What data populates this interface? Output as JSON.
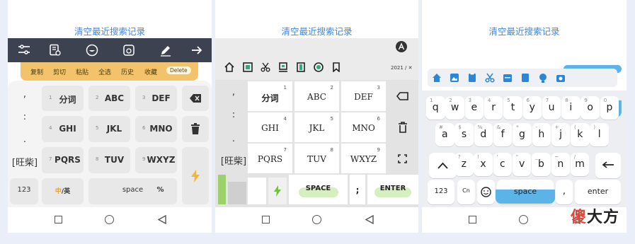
{
  "clear_history": "清空最近搜索记录",
  "panel1": {
    "clipboard": [
      "复制",
      "剪切",
      "粘贴",
      "全选",
      "历史",
      "收藏"
    ],
    "delete_label": "Delete",
    "side": [
      ",",
      ":",
      ".",
      "[旺柴]"
    ],
    "keys": [
      {
        "num": "1",
        "label": "分词"
      },
      {
        "num": "2",
        "label": "ABC"
      },
      {
        "num": "3",
        "label": "DEF"
      },
      {
        "num": "4",
        "label": "GHI"
      },
      {
        "num": "5",
        "label": "JKL"
      },
      {
        "num": "6",
        "label": "MNO"
      },
      {
        "num": "7",
        "label": "PQRS"
      },
      {
        "num": "8",
        "label": "TUV"
      },
      {
        "num": "9",
        "label": "WXYZ"
      }
    ],
    "bottom": {
      "k123": "123",
      "lang_cn": "中",
      "lang_sep": "/英",
      "space": "space",
      "percent": "%"
    }
  },
  "panel2": {
    "date": "2021 / ✕",
    "side": [
      ",",
      ":",
      ".",
      "[旺柴]"
    ],
    "keys": [
      {
        "num": "1",
        "label": "分词"
      },
      {
        "num": "2",
        "label": "ABC"
      },
      {
        "num": "3",
        "label": "DEF"
      },
      {
        "num": "4",
        "label": "GHI"
      },
      {
        "num": "5",
        "label": "JKL"
      },
      {
        "num": "6",
        "label": "MNO"
      },
      {
        "num": "7",
        "label": "PQRS"
      },
      {
        "num": "8",
        "label": "TUV"
      },
      {
        "num": "9",
        "label": "WXYZ"
      }
    ],
    "bottom": {
      "space": "SPACE",
      "semi": ";",
      "enter": "ENTER"
    }
  },
  "panel3": {
    "row1": [
      {
        "sub": "1",
        "label": "q"
      },
      {
        "sub": "2",
        "label": "w"
      },
      {
        "sub": "3",
        "label": "e"
      },
      {
        "sub": "4",
        "label": "r"
      },
      {
        "sub": "5",
        "label": "t"
      },
      {
        "sub": "6",
        "label": "y"
      },
      {
        "sub": "7",
        "label": "u"
      },
      {
        "sub": "8",
        "label": "i"
      },
      {
        "sub": "9",
        "label": "o"
      },
      {
        "sub": "0",
        "label": "p"
      }
    ],
    "row2": [
      {
        "sub": "#",
        "label": "a"
      },
      {
        "sub": "$",
        "label": "s"
      },
      {
        "sub": "%",
        "label": "d"
      },
      {
        "sub": "&",
        "label": "f"
      },
      {
        "sub": "*",
        "label": "g"
      },
      {
        "sub": "-",
        "label": "h"
      },
      {
        "sub": "+",
        "label": "j"
      },
      {
        "sub": "(",
        "label": "k"
      },
      {
        "sub": ")",
        "label": "l"
      }
    ],
    "row3": [
      {
        "sub": "?",
        "label": "z"
      },
      {
        "sub": "!",
        "label": "x"
      },
      {
        "sub": "'",
        "label": "c"
      },
      {
        "sub": "\"",
        "label": "v"
      },
      {
        "sub": "_",
        "label": "b"
      },
      {
        "sub": "~",
        "label": "n"
      },
      {
        "sub": "/",
        "label": "m"
      }
    ],
    "bottom": {
      "k123": "123",
      "cn": "Cn",
      "space": "space",
      "comma": ",",
      "enter": "enter"
    }
  },
  "watermark": {
    "first": "傻",
    "rest": "大方"
  }
}
